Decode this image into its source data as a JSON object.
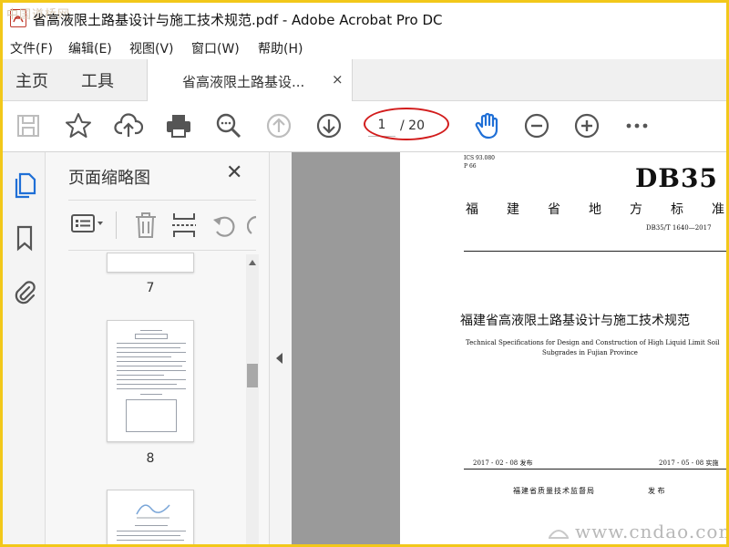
{
  "window": {
    "title": "省高液限土路基设计与施工技术规范.pdf - Adobe Acrobat Pro DC",
    "watermark": "中国道桥网"
  },
  "menu": [
    "文件(F)",
    "编辑(E)",
    "视图(V)",
    "窗口(W)",
    "帮助(H)"
  ],
  "tabs": {
    "home": "主页",
    "tools": "工具",
    "document": "省高液限土路基设...",
    "close_glyph": "×"
  },
  "toolbar": {
    "current_page": "1",
    "total_pages": "/ 20",
    "highlight_color": "#d21c1c",
    "hand_color": "#1f6fd6"
  },
  "panel": {
    "title": "页面缩略图",
    "close_glyph": "✕",
    "thumbnails": [
      {
        "page_label": "7"
      },
      {
        "page_label": "8"
      }
    ]
  },
  "document": {
    "ics": "ICS  93.080",
    "p_code": "P  66",
    "standard_logo": "DB35",
    "province_chars": [
      "福",
      "建",
      "省",
      "地",
      "方",
      "标",
      "准"
    ],
    "standard_number": "DB35/T  1640—2017",
    "title_cn": "福建省高液限土路基设计与施工技术规范",
    "title_en_line1": "Technical Specifications for Design and Construction of High Liquid Limit Soil",
    "title_en_line2": "Subgrades in Fujian Province",
    "issue_date": "2017 - 02 - 08 发布",
    "impl_date": "2017 - 05 - 08 实施",
    "issuer": "福建省质量技术监督局",
    "issuer_action": "发  布"
  },
  "bottom_watermark": "www.cndao.com"
}
